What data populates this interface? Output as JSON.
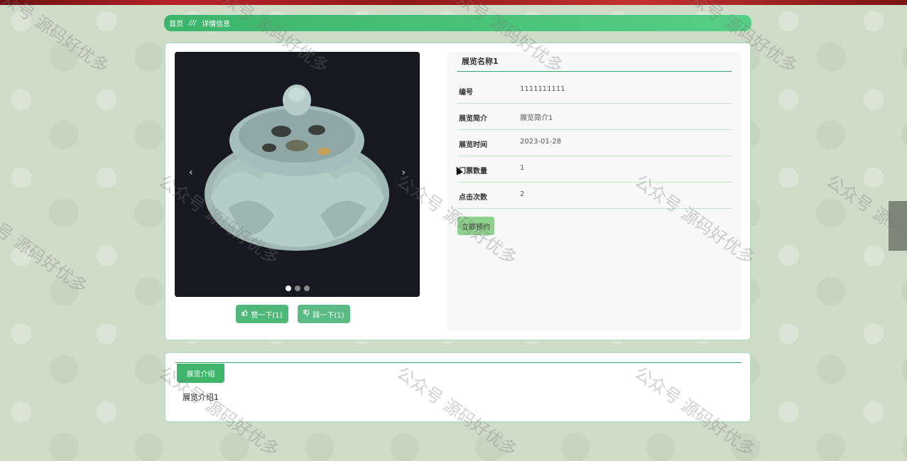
{
  "breadcrumb": {
    "home": "首页",
    "separator": "///",
    "current": "详情信息"
  },
  "exhibition": {
    "title": "展览名称1",
    "fields": [
      {
        "label": "编号",
        "value": "1111111111"
      },
      {
        "label": "展览简介",
        "value": "展览简介1"
      },
      {
        "label": "展览时间",
        "value": "2023-01-28"
      },
      {
        "label": "门票数量",
        "value": "1"
      },
      {
        "label": "点击次数",
        "value": "2"
      }
    ],
    "book_button": "立即预约"
  },
  "carousel": {
    "prev_glyph": "‹",
    "next_glyph": "›",
    "slide_count": 3,
    "active_slide": 1
  },
  "votes": {
    "like_label": "赞一下(1)",
    "dislike_label": "踩一下(1)",
    "like_icon": "thumbs-up-icon",
    "dislike_icon": "thumbs-down-icon"
  },
  "intro": {
    "tab_label": "展览介绍",
    "content": "展览介绍1"
  },
  "watermark": "公众号 源码好优多",
  "colors": {
    "accent": "#3fb56c",
    "button": "#4fb878",
    "book_button": "#8fd18d"
  }
}
